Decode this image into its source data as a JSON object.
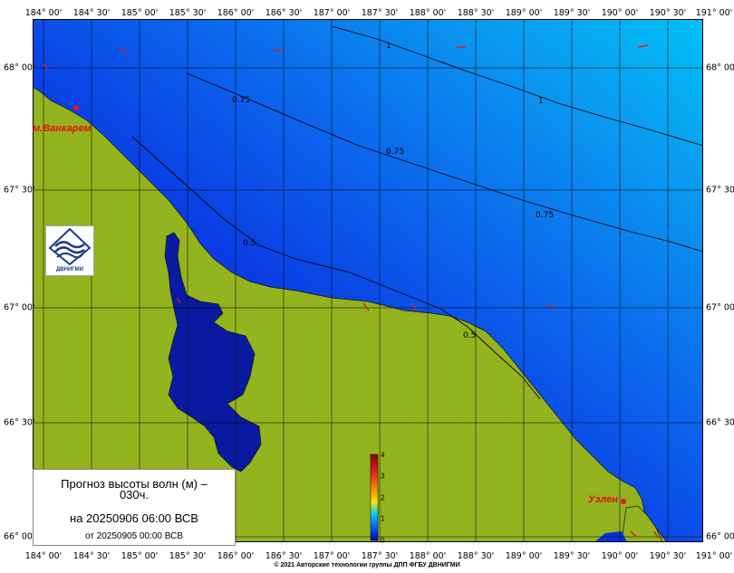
{
  "title": {
    "line1": "Прогноз высоты волн (м) –",
    "line2": "030ч.",
    "forecast_time": "на 20250906 06:00 ВСВ",
    "base_time": "от 20250905 00:00 ВСВ"
  },
  "copyright": "© 2021 Авторские технологии группы ДПП ФГБУ ДВНИГМИ",
  "logo_text": "ДВНИГМИ",
  "places": [
    "м.Ванкарем",
    "Уэлен"
  ],
  "lon_ticks": [
    "184° 00'",
    "184° 30'",
    "185° 00'",
    "185° 30'",
    "186° 00'",
    "186° 30'",
    "187° 00'",
    "187° 30'",
    "188° 00'",
    "188° 30'",
    "189° 00'",
    "189° 30'",
    "190° 00'",
    "190° 30'",
    "191° 00'"
  ],
  "lat_ticks": [
    "68° 00'",
    "67° 30'",
    "67° 00'",
    "66° 30'",
    "66° 00'"
  ],
  "colorbar": {
    "labels": [
      "4",
      "3",
      "2",
      "1",
      "0"
    ],
    "colors": [
      "#8a0000",
      "#e02020",
      "#ff8800",
      "#ffe800",
      "#00c8ff",
      "#0060ff",
      "#0000b0"
    ]
  },
  "contours": [
    "1",
    "1",
    "0.75",
    "0.75",
    "0.75",
    "0.5",
    "0.5"
  ],
  "colors": {
    "land": "#93b31f",
    "sea_shallow": "#1020c8",
    "sea_deep": "#00b4f2",
    "lagoon": "#0a1aa0",
    "arrow": "#e01818"
  }
}
